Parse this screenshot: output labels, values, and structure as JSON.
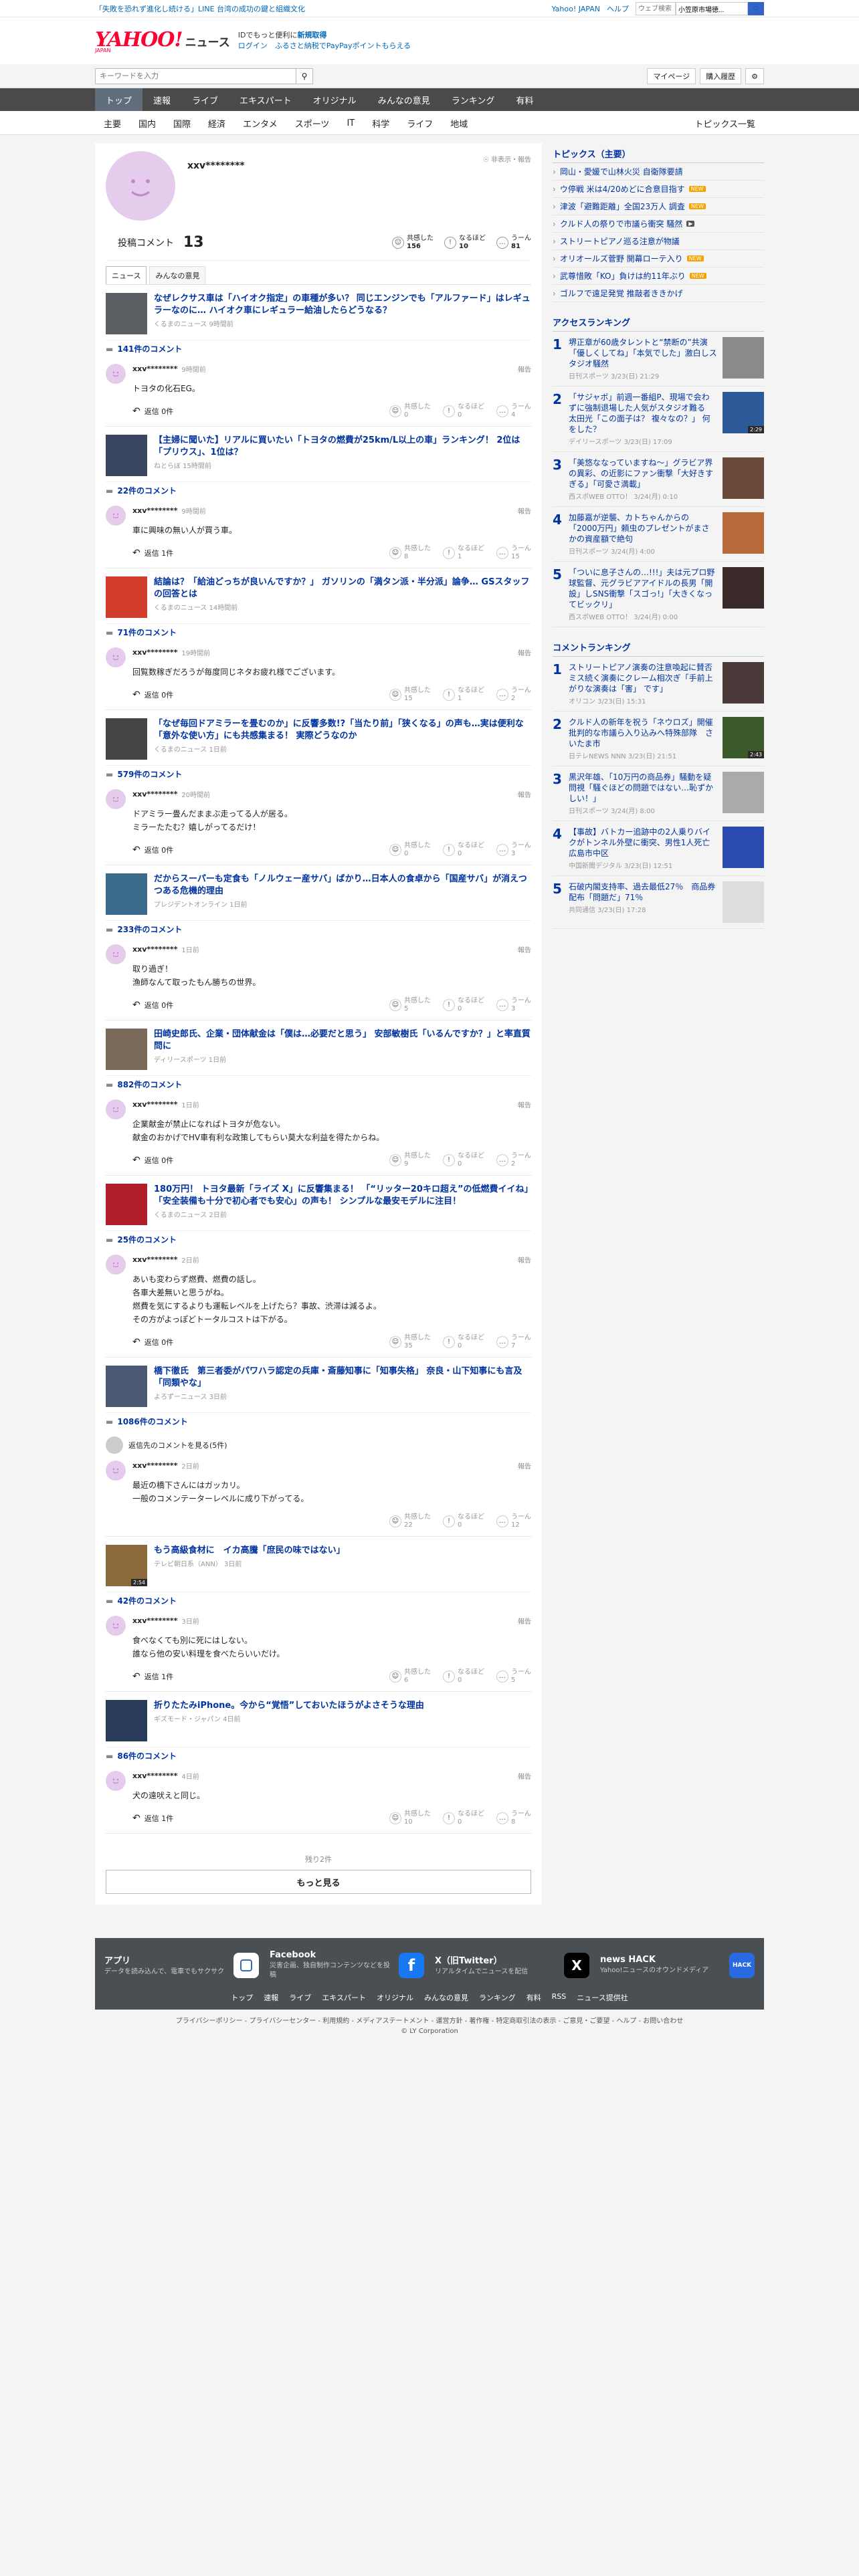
{
  "topbar": {
    "promo": "「失敗を恐れず進化し続ける」LINE 台湾の成功の鍵と組織文化",
    "yahoo_japan": "Yahoo! JAPAN",
    "help": "ヘルプ",
    "search_placeholder": "ウェブ検索",
    "location": "小笠原市場徳..."
  },
  "header": {
    "logo_main": "YAHOO!",
    "logo_sub": "ニュース",
    "logo_jp": "JAPAN",
    "line1": "IDでもっと便利に",
    "line1_link": "新規取得",
    "line2": "ログイン",
    "line2_rest": "ふるさと納税でPayPayポイントもらえる"
  },
  "searchbar": {
    "placeholder": "キーワードを入力",
    "mypage": "マイページ",
    "history": "購入履歴"
  },
  "gnav": [
    "トップ",
    "速報",
    "ライブ",
    "エキスパート",
    "オリジナル",
    "みんなの意見",
    "ランキング",
    "有料"
  ],
  "snav": {
    "items": [
      "主要",
      "国内",
      "国際",
      "経済",
      "エンタメ",
      "スポーツ",
      "IT",
      "科学",
      "ライフ",
      "地域"
    ],
    "last": "トピックス一覧"
  },
  "profile": {
    "name": "xxv********",
    "hide_report": "非表示・報告",
    "posted_label": "投稿コメント",
    "posted_count": "13",
    "reactions": [
      {
        "label": "共感した",
        "count": "156"
      },
      {
        "label": "なるほど",
        "count": "10"
      },
      {
        "label": "うーん",
        "count": "81"
      }
    ]
  },
  "tabs": [
    "ニュース",
    "みんなの意見"
  ],
  "reaction_labels": {
    "a": "共感した",
    "b": "なるほど",
    "c": "うーん"
  },
  "reply_label": "返信",
  "report_label": "報告",
  "items": [
    {
      "title": "なぜレクサス車は「ハイオク指定」の車種が多い？ 同じエンジンでも「アルファード」はレギュラーなのに… ハイオク車にレギュラー給油したらどうなる？",
      "src": "くるまのニュース 9時間前",
      "count": "141件のコメント",
      "user": "xxv********",
      "time": "9時間前",
      "text": "トヨタの化石EG。",
      "reply": "返信 0件",
      "r": [
        "0",
        "0",
        "4"
      ],
      "tc": "#5b5e63"
    },
    {
      "title": "【主婦に聞いた】リアルに買いたい「トヨタの燃費が25km/L以上の車」ランキング！ 2位は「プリウス」、1位は？",
      "src": "ねとらぼ 15時間前",
      "count": "22件のコメント",
      "user": "xxv********",
      "time": "9時間前",
      "text": "車に興味の無い人が買う車。",
      "reply": "返信 1件",
      "r": [
        "8",
        "1",
        "15"
      ],
      "tc": "#3a4660"
    },
    {
      "title": "結論は？「給油どっちが良いんですか？」 ガソリンの「満タン派・半分派」論争… GSスタッフの回答とは",
      "src": "くるまのニュース 14時間前",
      "count": "71件のコメント",
      "user": "xxv********",
      "time": "19時間前",
      "text": "回覧数稼ぎだろうが毎度同じネタお疲れ様でございます。",
      "reply": "返信 0件",
      "r": [
        "15",
        "1",
        "2"
      ],
      "tc": "#d23c2a"
    },
    {
      "title": "「なぜ毎回ドアミラーを畳むのか」に反響多数!?「当たり前」「狭くなる」の声も…実は便利な「意外な使い方」にも共感集まる！ 実際どうなのか",
      "src": "くるまのニュース 1日前",
      "count": "579件のコメント",
      "user": "xxv********",
      "time": "20時間前",
      "text": "ドアミラー畳んだままぶ走ってる人が居る。\nミラーたたむ？嬉しがってるだけ！",
      "reply": "返信 0件",
      "r": [
        "0",
        "0",
        "3"
      ],
      "tc": "#444444"
    },
    {
      "title": "だからスーパーも定食も「ノルウェー産サバ」ばかり…日本人の食卓から「国産サバ」が消えつつある危機的理由",
      "src": "プレジデントオンライン 1日前",
      "count": "233件のコメント",
      "user": "xxv********",
      "time": "1日前",
      "text": "取り過ぎ！\n漁師なんて取ったもん勝ちの世界。",
      "reply": "返信 0件",
      "r": [
        "5",
        "0",
        "3"
      ],
      "tc": "#3c6a8c"
    },
    {
      "title": "田崎史郎氏、企業・団体献金は「僕は…必要だと思う」 安部敏樹氏「いるんですか？」と率直質問に",
      "src": "ディリースポーツ 1日前",
      "count": "882件のコメント",
      "user": "xxv********",
      "time": "1日前",
      "text": "企業献金が禁止になればトヨタが危ない。\n献金のおかげでHV車有利な政策してもらい莫大な利益を得たからね。",
      "reply": "返信 0件",
      "r": [
        "9",
        "0",
        "2"
      ],
      "tc": "#7a6a5a"
    },
    {
      "title": "180万円！ トヨタ最新「ライズ X」に反響集まる！ 「“リッター20キロ超え”の低燃費イイね」「安全装備も十分で初心者でも安心」の声も！ シンプルな最安モデルに注目！",
      "src": "くるまのニュース 2日前",
      "count": "25件のコメント",
      "user": "xxv********",
      "time": "2日前",
      "text": "あいも変わらず燃費、燃費の話し。\n各車大差無いと思うがね。\n燃費を気にするよりも運転レベルを上げたら？事故、渋滞は減るよ。\nその方がよっぽどトータルコストは下がる。",
      "reply": "返信 0件",
      "r": [
        "35",
        "0",
        "7"
      ],
      "tc": "#b01e2a"
    },
    {
      "title": "橋下徹氏　第三者委がパワハラ認定の兵庫・斎藤知事に「知事失格」 奈良・山下知事にも言及「同類やな」",
      "src": "よろずーニュース 3日前",
      "count": "1086件のコメント",
      "prev": "返信先のコメントを見る(5件)",
      "user": "xxv********",
      "time": "2日前",
      "text": "最近の橋下さんにはガッカリ。\n一般のコメンテーターレベルに成り下がってる。",
      "reply": "",
      "r": [
        "22",
        "0",
        "12"
      ],
      "tc": "#4b5a72"
    },
    {
      "title": "もう高級食材に　イカ高騰「庶民の味ではない」",
      "src": "テレビ朝日系（ANN） 3日前",
      "badge": "2:54",
      "count": "42件のコメント",
      "user": "xxv********",
      "time": "3日前",
      "text": "食べなくても別に死にはしない。\n誰なら他の安い料理を食べたらいいだけ。",
      "reply": "返信 1件",
      "r": [
        "6",
        "0",
        "5"
      ],
      "tc": "#8a6a3a"
    },
    {
      "title": "折りたたみiPhone。今から“覚悟”しておいたほうがよさそうな理由",
      "src": "ギズモード・ジャパン 4日前",
      "count": "86件のコメント",
      "user": "xxv********",
      "time": "4日前",
      "text": "犬の遠吠えと同じ。",
      "reply": "返信 1件",
      "r": [
        "10",
        "0",
        "8"
      ],
      "tc": "#2a3a5a"
    }
  ],
  "remain": "残り2件",
  "more": "もっと見る",
  "topics": {
    "heading": "トピックス（主要）",
    "items": [
      {
        "t": "岡山・愛媛で山林火災 自衛隊要請",
        "tag": ""
      },
      {
        "t": "ウ停戦 米は4/20めどに合意目指す",
        "tag": "NEW"
      },
      {
        "t": "津波「避難距離」全国23万人 調査",
        "tag": "NEW"
      },
      {
        "t": "クルド人の祭りで市議ら衝突 騒然",
        "tag": "film"
      },
      {
        "t": "ストリートピアノ巡る注意が物議",
        "tag": ""
      },
      {
        "t": "オリオールズ菅野 開幕ローテ入り",
        "tag": "NEW"
      },
      {
        "t": "武尊惜敗「KO」負けは約11年ぶり",
        "tag": "NEW"
      },
      {
        "t": "ゴルフで遠足発覚 推敲者ききかげ",
        "tag": ""
      }
    ]
  },
  "access": {
    "heading": "アクセスランキング",
    "items": [
      {
        "n": "1",
        "t": "堺正章が60歳タレントと“禁断の”共演「優しくしてね」「本気でした」激白しスタジオ騒然",
        "s": "日刊スポーツ 3/23(日) 21:29",
        "c": "#8a8a8a"
      },
      {
        "n": "2",
        "t": "「サジャボ」前週一番組P、現場で会わずに強制退場した人気がスタジオ難る　太田光「この面子は？ 複々なの？」 何をした？",
        "s": "デイリースポーツ 3/23(日) 17:09",
        "c": "#2f5a9a",
        "b": "2:29"
      },
      {
        "n": "3",
        "t": "「美悠ななっていますね～」グラビア界の異彩、の近影にファン衝撃「大好きすぎる」「可愛さ満載」",
        "s": "西スポWEB OTTO！ 3/24(月) 0:10",
        "c": "#6a4a3a"
      },
      {
        "n": "4",
        "t": "加藤嘉が逆襲、カトちゃんからの「2000万円」頼虫のプレゼントがまさかの資産額で絶句",
        "s": "日刊スポーツ 3/24(月) 4:00",
        "c": "#b86a3a"
      },
      {
        "n": "5",
        "t": "「ついに息子さんの…!!!」夫は元プロ野球監督、元グラビアアイドルの長男「開設」しSNS衝撃「スゴっ!」「大きくなってビックリ」",
        "s": "西スポWEB OTTO！ 3/24(月) 0:00",
        "c": "#3a2a2a"
      }
    ]
  },
  "comment_rank": {
    "heading": "コメントランキング",
    "items": [
      {
        "n": "1",
        "t": "ストリートピアノ演奏の注意喚起に賛否　ミス続く演奏にクレーム相次ぎ「手前上がりな演奏は「害」 です」",
        "s": "オリコン 3/23(日) 15:31",
        "c": "#4a3a3a"
      },
      {
        "n": "2",
        "t": "クルド人の新年を祝う「ネウロズ」開催　批判的な市議ら入り込みへ特殊部隊　さいたま市",
        "s": "日テレNEWS NNN 3/23(日) 21:51",
        "c": "#3a5a2a",
        "b": "2:43"
      },
      {
        "n": "3",
        "t": "黒沢年雄、「10万円の商品券」騒動を疑問視「騒ぐほどの問題ではない…恥ずかしい！」",
        "s": "日刊スポーツ 3/24(月) 8:00",
        "c": "#aaaaaa"
      },
      {
        "n": "4",
        "t": "【事故】バトカー追跡中の2人乗りバイクがトンネル外壁に衝突、男性1人死亡　広島市中区",
        "s": "中国新聞デジタル 3/23(日) 12:51",
        "c": "#2a4ab0"
      },
      {
        "n": "5",
        "t": "石破内閣支持率、過去最低27％　商品券配布「問題だ」71％",
        "s": "共同通信 3/23(日) 17:28",
        "c": "#dddddd"
      }
    ]
  },
  "footer": {
    "apps": [
      {
        "t1": "アプリ",
        "t2": "データを読み込んで、電車でもサクサク"
      },
      {
        "t1": "Facebook",
        "t2": "災害企画、独自制作コンテンツなどを投稿"
      },
      {
        "t1": "X（旧Twitter）",
        "t2": "リアルタイムでニュースを配信"
      },
      {
        "t1": "news HACK",
        "t2": "Yahoo!ニュースのオウンドメディア"
      }
    ],
    "links": [
      "トップ",
      "速報",
      "ライブ",
      "エキスパート",
      "オリジナル",
      "みんなの意見",
      "ランキング",
      "有料",
      "RSS",
      "ニュース提供社"
    ],
    "legal": "プライバシーポリシー - プライバシーセンター - 利用規約 - メディアステートメント - 運営方針 - 著作権 - 特定商取引法の表示 - ご意見・ご要望 - ヘルプ - お問い合わせ",
    "copy": "© LY Corporation"
  }
}
